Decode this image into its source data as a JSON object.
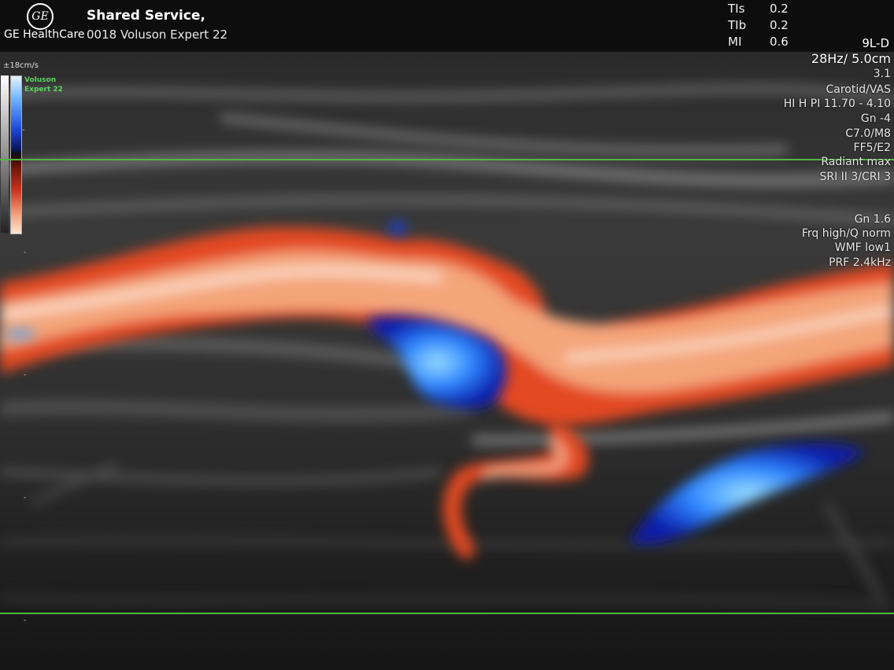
{
  "header": {
    "logo_text": "GE",
    "brand": "GE HealthCare",
    "site": "Shared Service,",
    "system": "0018 Voluson Expert 22",
    "indices": [
      {
        "label": "TIs",
        "value": "0.2"
      },
      {
        "label": "TIb",
        "value": "0.2"
      },
      {
        "label": "MI",
        "value": "0.6"
      }
    ],
    "probe": "9L-D"
  },
  "colorbar": {
    "scale_label": "±18cm/s",
    "product_line1": "Voluson",
    "product_line2": "Expert 22",
    "ticks": [
      "-",
      "-",
      "-",
      "-",
      "-",
      "-"
    ]
  },
  "params": {
    "frame_depth": "28Hz/ 5.0cm",
    "value": "3.1",
    "preset": "Carotid/VAS",
    "harmonic": "HI H PI 11.70 - 4.10",
    "gain": "Gn -4",
    "map": "C7.0/M8",
    "ff": "FF5/E2",
    "radiant": "Radiant max",
    "sri": "SRI II 3/CRI 3",
    "color_gain": "Gn 1.6",
    "frequency": "Frq high/Q norm",
    "wmf": "WMF low1",
    "prf": "PRF 2.4kHz"
  },
  "colors": {
    "roi_line": "#4fb83f",
    "product_green": "#5dd65d",
    "flow_red": "#e34a24",
    "flow_blue": "#2a6cff"
  },
  "icons": {
    "logo": "ge-logo-icon"
  }
}
